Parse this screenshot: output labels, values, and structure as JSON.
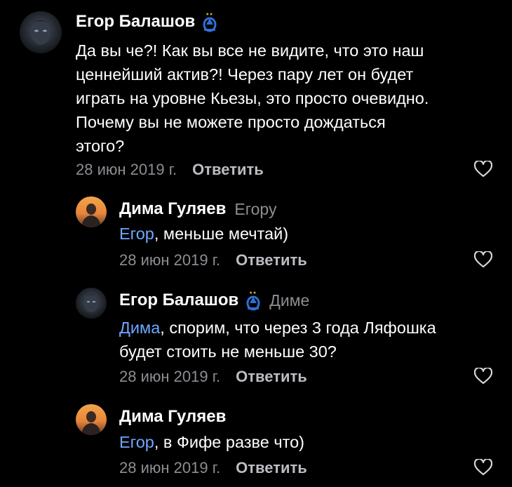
{
  "comments": [
    {
      "author": "Егор Балашов",
      "text_lines": [
        "Да вы че?! Как вы все не видите, что это наш",
        "ценнейший актив?! Через пару лет он будет",
        "играть на уровне Кьезы, это просто очевидно.",
        "Почему вы не можете просто дождаться",
        "этого?"
      ],
      "date": "28 июн 2019 г.",
      "reply_label": "Ответить",
      "avatar_icon": "avatar-dark-portrait",
      "badge_icon": "dynamo-club-badge-icon"
    },
    {
      "author": "Дима Гуляев",
      "reply_to": "Егору",
      "mention": "Егор",
      "text": ", меньше мечтай)",
      "date": "28 июн 2019 г.",
      "reply_label": "Ответить",
      "avatar_icon": "avatar-sunset-photo"
    },
    {
      "author": "Егор Балашов",
      "reply_to": "Диме",
      "mention": "Дима",
      "text": ", спорим, что через 3 года Ляфошка",
      "text_line2": "будет стоить не меньше 30?",
      "date": "28 июн 2019 г.",
      "reply_label": "Ответить",
      "avatar_icon": "avatar-dark-portrait",
      "badge_icon": "dynamo-club-badge-icon"
    },
    {
      "author": "Дима Гуляев",
      "mention": "Егор",
      "text": ", в Фифе разве что)",
      "date": "28 июн 2019 г.",
      "reply_label": "Ответить",
      "avatar_icon": "avatar-sunset-photo"
    }
  ],
  "colors": {
    "background": "#000000",
    "mention": "#6ea8ff",
    "secondary_text": "#8d8d93",
    "badge_blue": "#2f6fd6"
  }
}
